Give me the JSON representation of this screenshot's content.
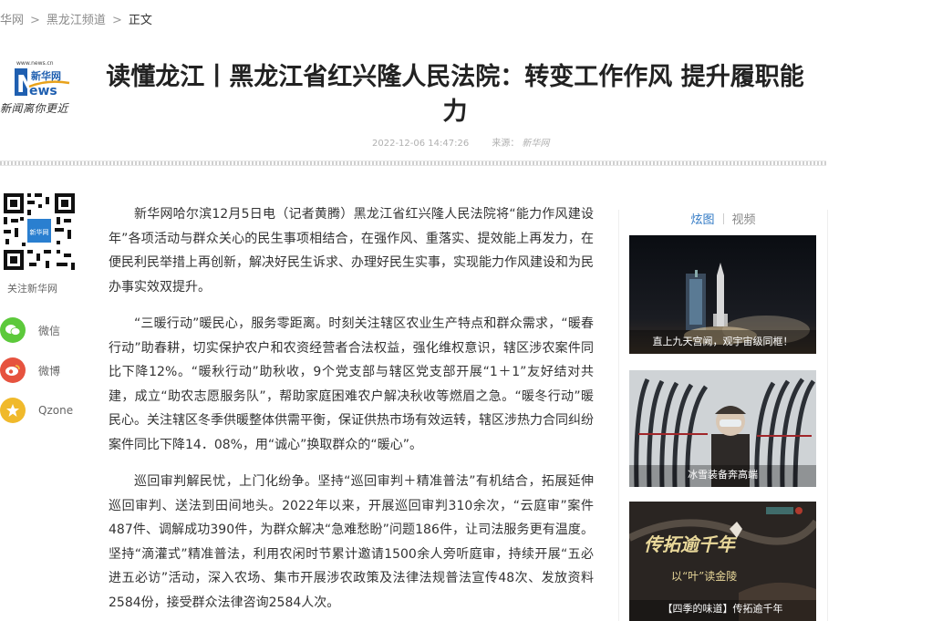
{
  "breadcrumb": {
    "items": [
      "华网",
      "黑龙江频道"
    ],
    "current": "正文",
    "separator": ">"
  },
  "logo": {
    "site_url": "www.news.cn",
    "brand_cn": "新华网",
    "brand_en": "ews",
    "brand_letter": "N",
    "slogan": "新闻离你更近"
  },
  "article": {
    "title": "读懂龙江丨黑龙江省红兴隆人民法院：转变工作作风 提升履职能力",
    "datetime": "2022-12-06 14:47:26",
    "source_label": "来源：",
    "source": "新华网",
    "paragraphs": [
      "新华网哈尔滨12月5日电（记者黄腾）黑龙江省红兴隆人民法院将“能力作风建设年”各项活动与群众关心的民生事项相结合，在强作风、重落实、提效能上再发力，在便民利民举措上再创新，解决好民生诉求、办理好民生实事，实现能力作风建设和为民办事实效双提升。",
      "“三暖行动”暖民心，服务零距离。时刻关注辖区农业生产特点和群众需求，“暖春行动”助春耕，切实保护农户和农资经营者合法权益，强化维权意识，辖区涉农案件同比下降12%。“暖秋行动”助秋收，9个党支部与辖区党支部开展“1＋1”友好结对共建，成立“助农志愿服务队”，帮助家庭困难农户解决秋收等燃眉之急。“暖冬行动”暖民心。关注辖区冬季供暖整体供需平衡，保证供热市场有效运转，辖区涉热力合同纠纷案件同比下降14．08%，用“诚心”换取群众的“暖心”。",
      "巡回审判解民忧，上门化纷争。坚持“巡回审判＋精准普法”有机结合，拓展延伸巡回审判、送法到田间地头。2022年以来，开展巡回审判310余次，“云庭审”案件487件、调解成功390件，为群众解决“急难愁盼”问题186件，让司法服务更有温度。坚持“滴灌式”精准普法，利用农闲时节累计邀请1500余人旁听庭审，持续开展“五必进五必访”活动，深入农场、集市开展涉农政策及法律法规普法宣传48次、发放资料2584份，接受群众法律咨询2584人次。"
    ]
  },
  "share": {
    "qr_caption": "关注新华网",
    "qr_center": "新华网",
    "items": [
      {
        "label": "微信",
        "icon": "wechat-icon",
        "color": "#5cc93b"
      },
      {
        "label": "微博",
        "icon": "weibo-icon",
        "color": "#e6533f"
      },
      {
        "label": "Qzone",
        "icon": "qzone-icon",
        "color": "#f0b92b"
      }
    ]
  },
  "sidebar": {
    "tabs": [
      "炫图",
      "视频"
    ],
    "cards": [
      {
        "caption": "直上九天宫阙，观宇宙级同框！"
      },
      {
        "caption": "冰雪装备奔高端"
      },
      {
        "caption": "【四季的味道】传拓逾千年",
        "overlay_title": "传拓逾千年",
        "overlay_sub": "以“叶”读金陵"
      }
    ]
  },
  "colors": {
    "accent_blue": "#2f78c4",
    "text_gray": "#8a8a8a"
  }
}
